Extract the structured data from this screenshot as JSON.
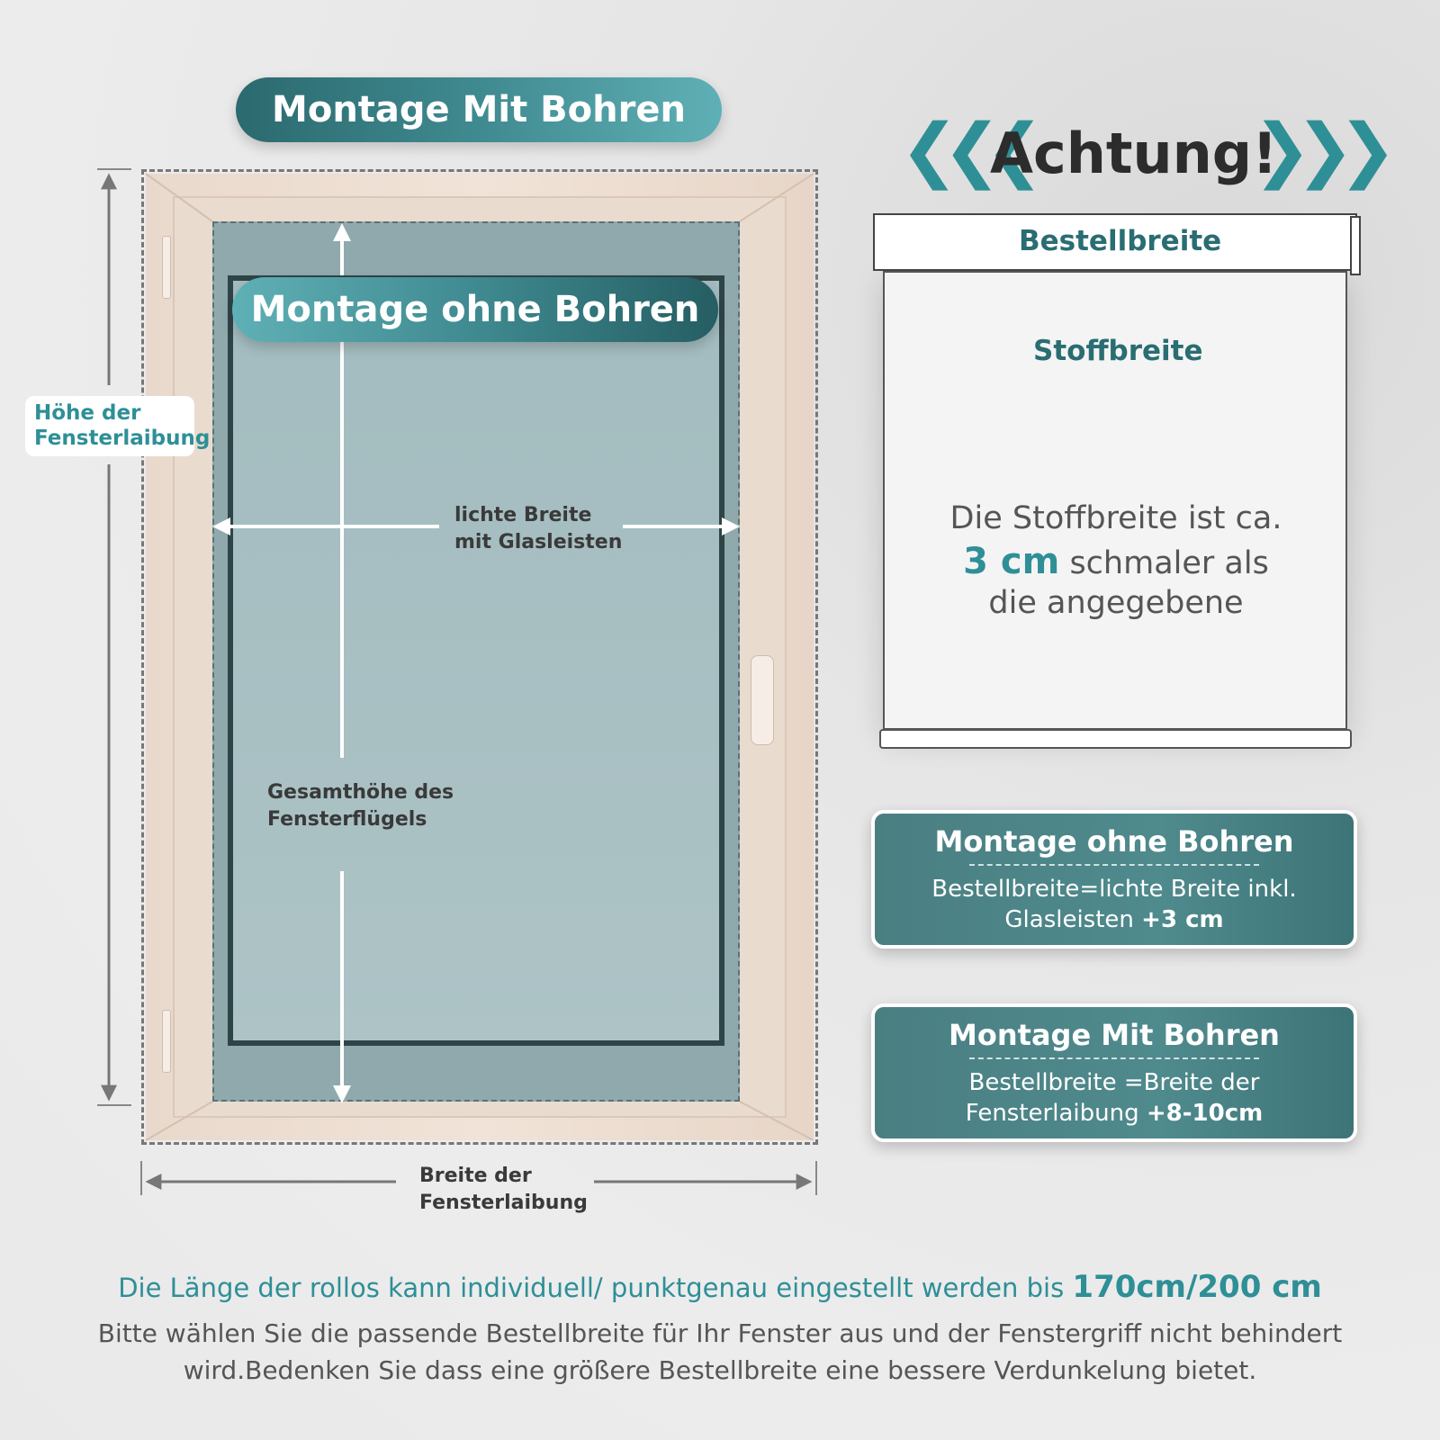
{
  "titles": {
    "montage_mit_bohren": "Montage Mit Bohren",
    "montage_ohne_bohren": "Montage ohne Bohren"
  },
  "labels": {
    "hoehe_line1": "Höhe der",
    "hoehe_line2": "Fensterlaibung",
    "lichte_line1": "lichte Breite",
    "lichte_line2": "mit Glasleisten",
    "gesamt_line1": "Gesamthöhe des",
    "gesamt_line2": "Fensterflügels",
    "breite_line1": "Breite der",
    "breite_line2": "Fensterlaibung"
  },
  "right": {
    "achtung": "Achtung!",
    "bestellbreite": "Bestellbreite",
    "stoffbreite": "Stoffbreite",
    "note_line1": "Die Stoffbreite ist ca.",
    "note_value": "3 cm",
    "note_line2_rest": " schmaler als",
    "note_line3": "die angegebene"
  },
  "boxes": [
    {
      "title": "Montage ohne Bohren",
      "line1": "Bestellbreite=lichte Breite inkl.",
      "line2_prefix": "Glasleisten ",
      "line2_bold": "+3 cm"
    },
    {
      "title": "Montage Mit Bohren",
      "line1": "Bestellbreite =Breite der",
      "line2_prefix": "Fensterlaibung ",
      "line2_bold": "+8-10cm"
    }
  ],
  "bottom": {
    "line1": "Die Länge der rollos kann individuell/ punktgenau eingestellt werden bis ",
    "line1_bold": "170cm/200 cm",
    "line2": "Bitte wählen Sie die passende Bestellbreite für Ihr Fenster aus und der Fenstergriff nicht behindert",
    "line3": "wird.Bedenken Sie dass eine größere Bestellbreite eine bessere Verdunkelung bietet."
  },
  "colors": {
    "accent_teal": "#2e8f97",
    "box_teal": "#4f8a8d"
  }
}
